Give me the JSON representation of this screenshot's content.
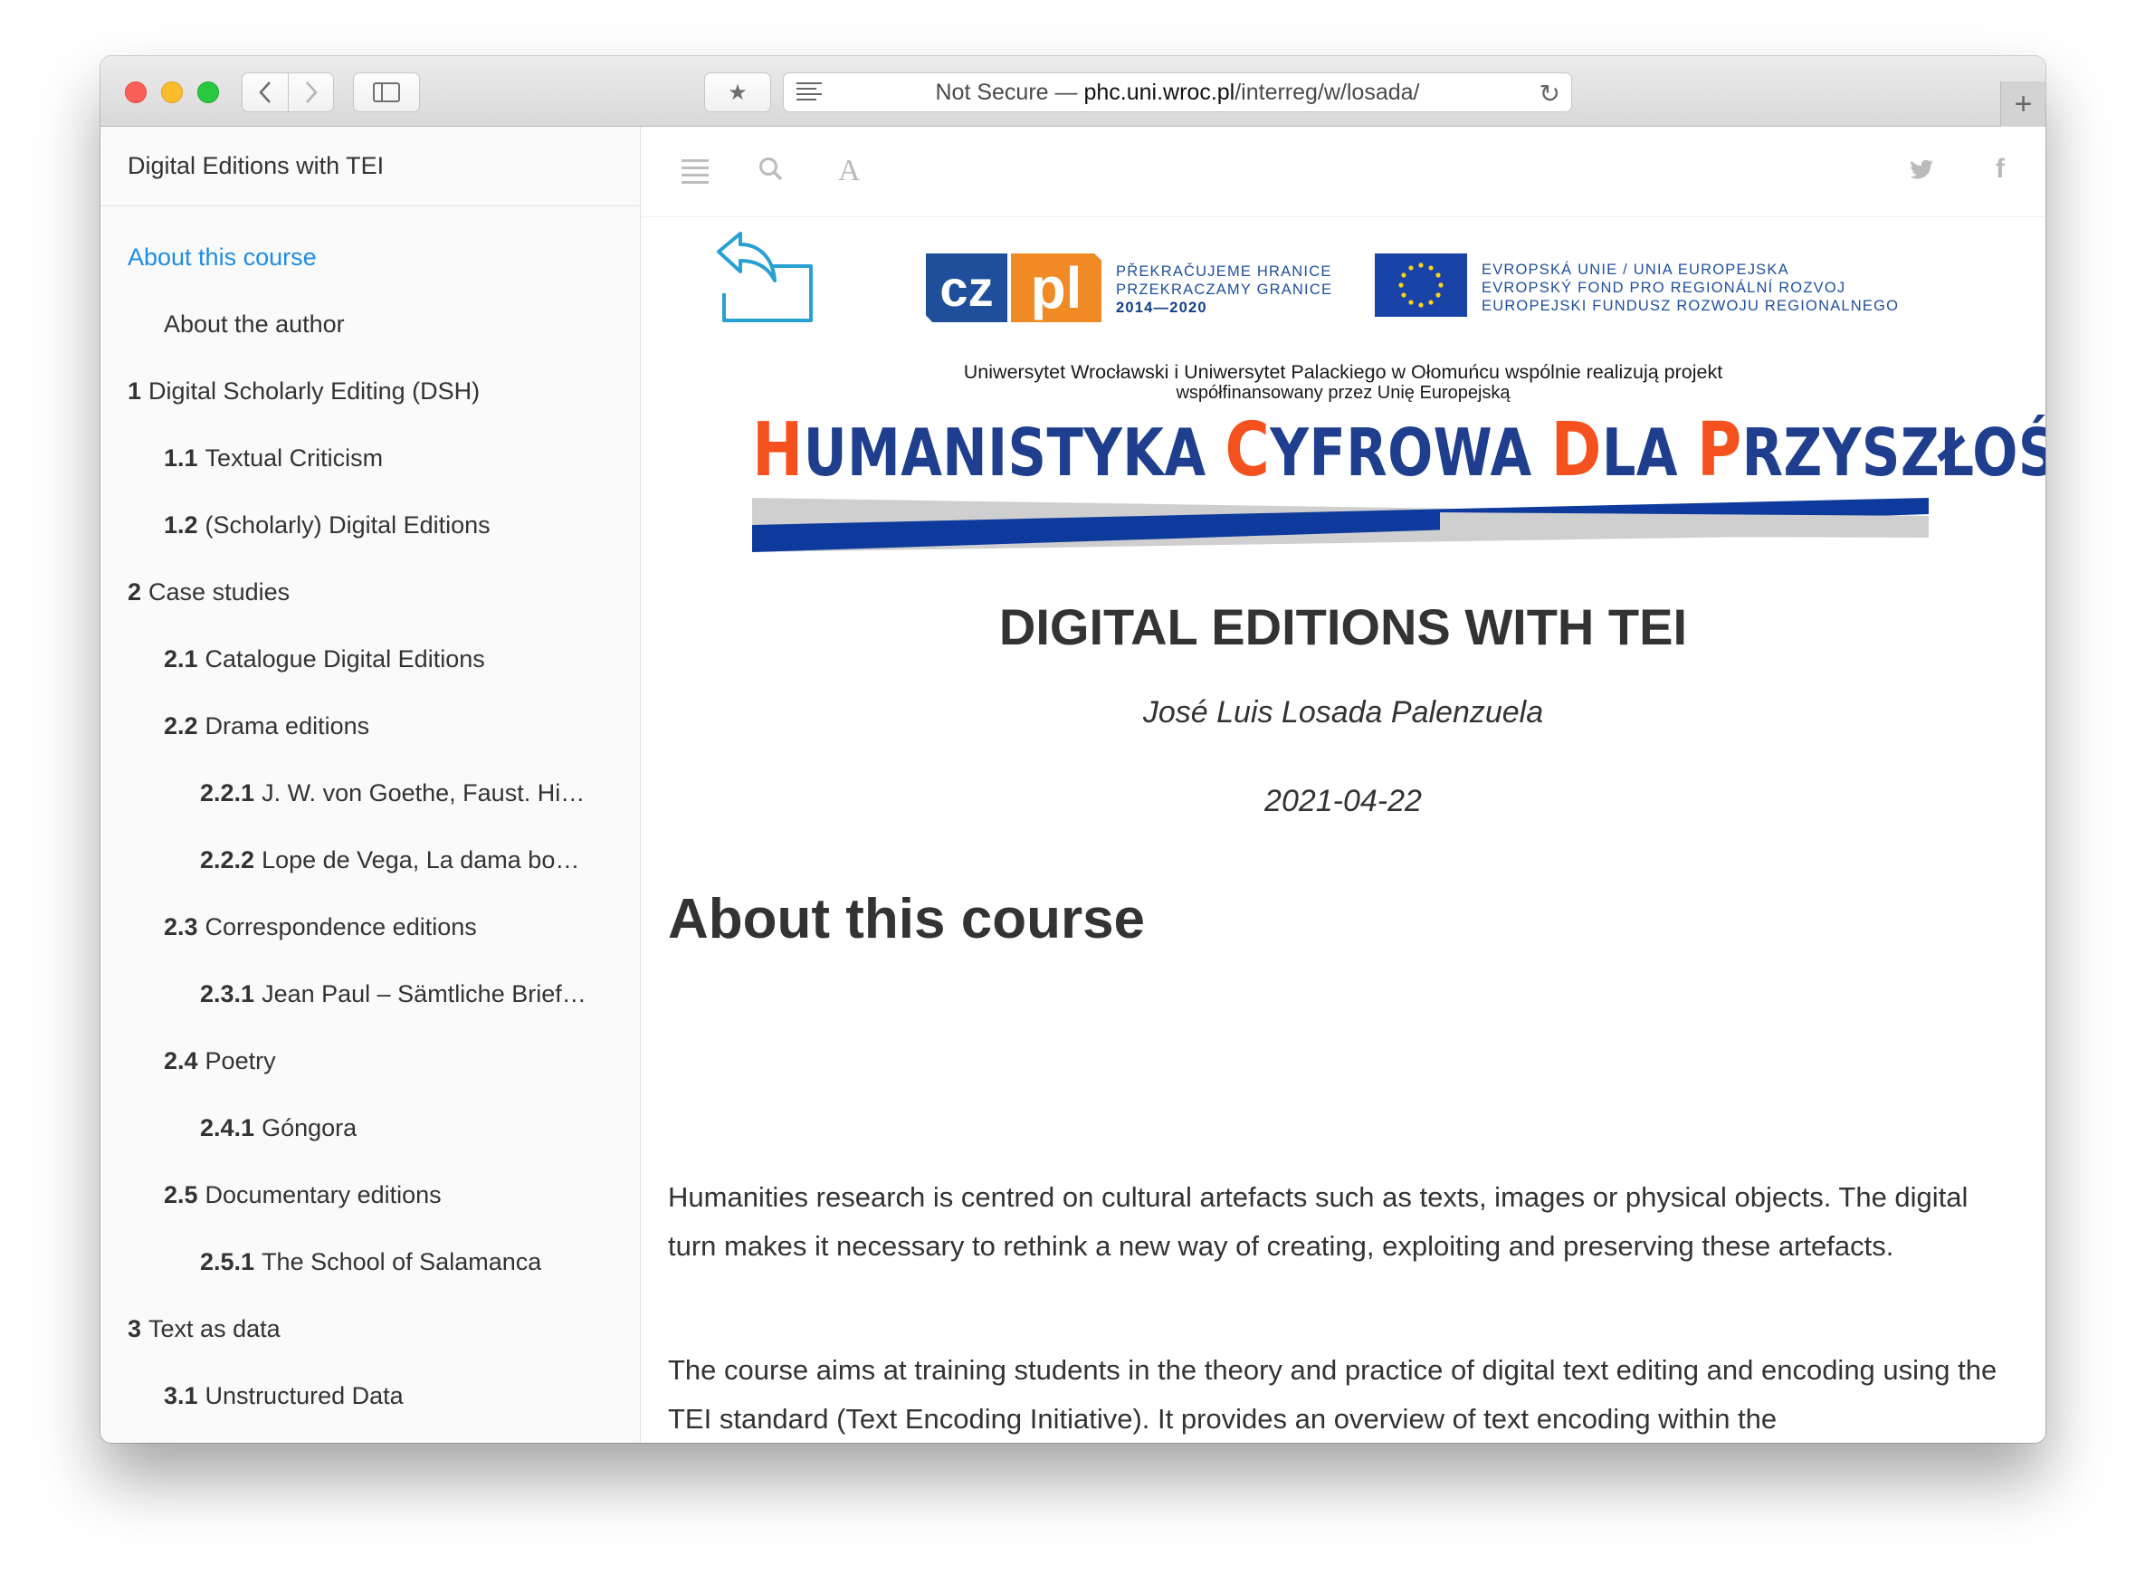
{
  "browser": {
    "url_prefix": "Not Secure — ",
    "url_host": "phc.uni.wroc.pl",
    "url_path": "/interreg/w/losada/"
  },
  "sidebar": {
    "book_title": "Digital Editions with TEI",
    "items": [
      {
        "num": "",
        "label": "About this course",
        "level": 0,
        "active": true
      },
      {
        "num": "",
        "label": "About the author",
        "level": 1
      },
      {
        "num": "1",
        "label": "Digital Scholarly Editing (DSH)",
        "level": 0
      },
      {
        "num": "1.1",
        "label": "Textual Criticism",
        "level": 1
      },
      {
        "num": "1.2",
        "label": "(Scholarly) Digital Editions",
        "level": 1
      },
      {
        "num": "2",
        "label": "Case studies",
        "level": 0
      },
      {
        "num": "2.1",
        "label": "Catalogue Digital Editions",
        "level": 1
      },
      {
        "num": "2.2",
        "label": "Drama editions",
        "level": 1
      },
      {
        "num": "2.2.1",
        "label": "J. W. von Goethe, Faust. Hi…",
        "level": 2
      },
      {
        "num": "2.2.2",
        "label": "Lope de Vega, La dama bo…",
        "level": 2
      },
      {
        "num": "2.3",
        "label": "Correspondence editions",
        "level": 1
      },
      {
        "num": "2.3.1",
        "label": "Jean Paul – Sämtliche Brief…",
        "level": 2
      },
      {
        "num": "2.4",
        "label": "Poetry",
        "level": 1
      },
      {
        "num": "2.4.1",
        "label": "Góngora",
        "level": 2
      },
      {
        "num": "2.5",
        "label": "Documentary editions",
        "level": 1
      },
      {
        "num": "2.5.1",
        "label": "The School of Salamanca",
        "level": 2
      },
      {
        "num": "3",
        "label": "Text as data",
        "level": 0
      },
      {
        "num": "3.1",
        "label": "Unstructured Data",
        "level": 1
      }
    ]
  },
  "toolbar": {
    "icons": [
      "menu-icon",
      "search-icon",
      "font-icon",
      "twitter-icon",
      "facebook-icon"
    ]
  },
  "banner": {
    "czpl_logo": "czpl",
    "czpl_line1": "PŘEKRAČUJEME HRANICE",
    "czpl_line2": "PRZEKRACZAMY GRANICE",
    "czpl_line3": "2014—2020",
    "eu_line1": "EVROPSKÁ UNIE / UNIA EUROPEJSKA",
    "eu_line2": "EVROPSKÝ FOND PRO REGIONÁLNÍ ROZVOJ",
    "eu_line3": "EUROPEJSKI FUNDUSZ ROZWOJU REGIONALNEGO",
    "project_line1": "Uniwersytet Wrocławski i Uniwersytet Palackiego w Ołomuńcu wspólnie realizują projekt",
    "project_line2": "współfinansowany przez Unię Europejską",
    "project_title": "HUMANISTYKA CYFROWA DLA PRZYSZŁOŚCI"
  },
  "document": {
    "title": "DIGITAL EDITIONS WITH TEI",
    "author": "José Luis Losada Palenzuela",
    "date": "2021-04-22",
    "section_heading": "About this course",
    "paragraph1": "Humanities research is centred on cultural artefacts such as texts, images or physical objects. The digital turn makes it necessary to rethink a new way of creating, exploiting and preserving these artefacts.",
    "paragraph2": "The course aims at training students in the theory and practice of digital text editing and encoding using the TEI standard (Text Encoding Initiative). It provides an overview of text encoding within the"
  },
  "colors": {
    "link_active": "#1f8ce2",
    "brand_blue": "#1f3f8e",
    "brand_orange": "#f5511e"
  }
}
